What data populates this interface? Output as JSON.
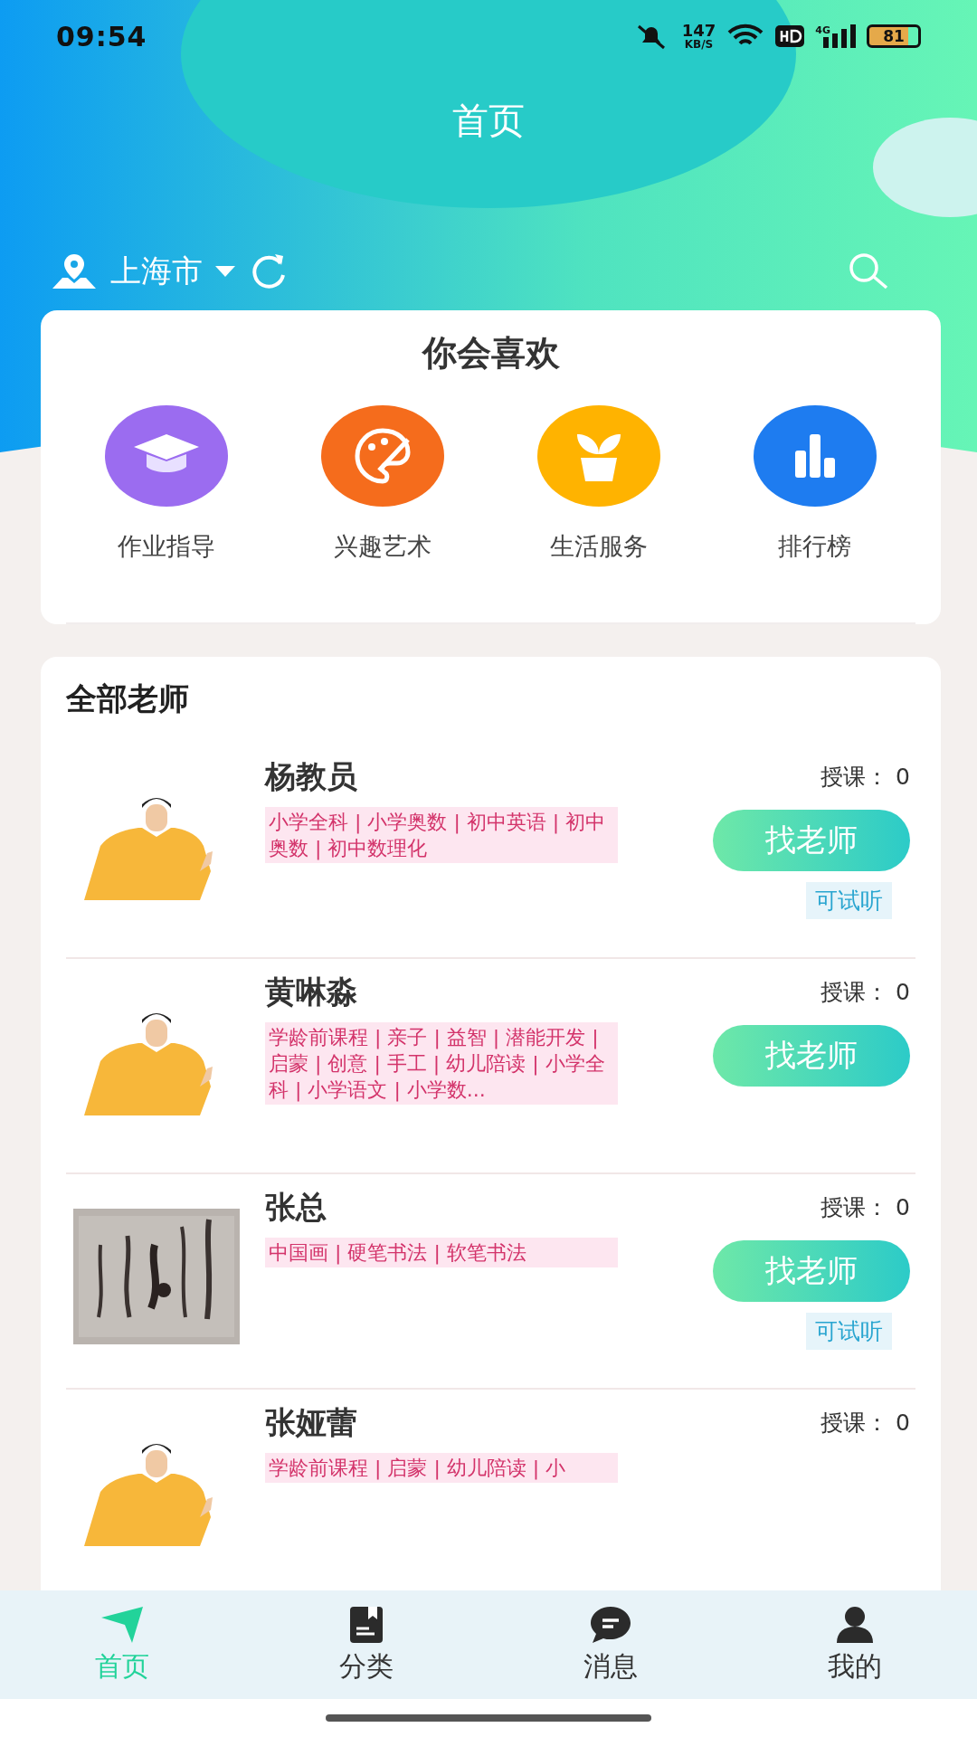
{
  "status_bar": {
    "time": "09:54",
    "net_speed": "147",
    "net_unit": "KB/S",
    "network": "4G",
    "battery": "81"
  },
  "header": {
    "title": "首页",
    "city": "上海市"
  },
  "recommend": {
    "title": "你会喜欢",
    "items": [
      {
        "label": "作业指导",
        "kind": "cap",
        "color": "#9b6cf0"
      },
      {
        "label": "兴趣艺术",
        "kind": "palette",
        "color": "#f56c1c"
      },
      {
        "label": "生活服务",
        "kind": "plant",
        "color": "#ffb300"
      },
      {
        "label": "排行榜",
        "kind": "chart",
        "color": "#1e7cf0"
      }
    ]
  },
  "teachers": {
    "title": "全部老师",
    "items": [
      {
        "name": "杨教员",
        "kind": "figure",
        "count_label": "授课：",
        "count": "0",
        "tags": "小学全科 | 小学奥数 | 初中英语 | 初中奥数 | 初中数理化",
        "button": "找老师",
        "trial": "可试听"
      },
      {
        "name": "黄啉淼",
        "kind": "figure",
        "count_label": "授课：",
        "count": "0",
        "tags": "学龄前课程 | 亲子 | 益智 | 潜能开发 | 启蒙 | 创意 | 手工 | 幼儿陪读 | 小学全科 | 小学语文 | 小学数...",
        "button": "找老师"
      },
      {
        "name": "张总",
        "kind": "picture",
        "count_label": "授课：",
        "count": "0",
        "tags": "中国画 | 硬笔书法 | 软笔书法",
        "button": "找老师",
        "trial": "可试听"
      },
      {
        "name": "张娅蕾",
        "kind": "figure",
        "count_label": "授课：",
        "count": "0",
        "tags": "学龄前课程 | 启蒙 | 幼儿陪读 | 小"
      }
    ]
  },
  "tabs": [
    {
      "label": "首页",
      "kind": "send",
      "selected": true
    },
    {
      "label": "分类",
      "kind": "book",
      "selected": false
    },
    {
      "label": "消息",
      "kind": "chat",
      "selected": false
    },
    {
      "label": "我的",
      "kind": "user",
      "selected": false
    }
  ]
}
